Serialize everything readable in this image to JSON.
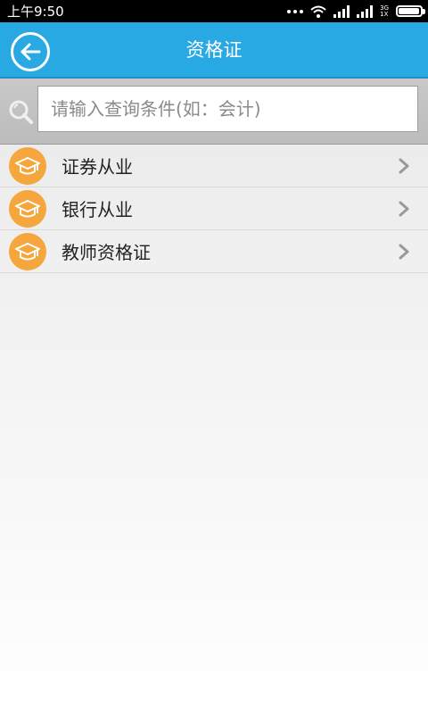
{
  "status_bar": {
    "time": "上午9:50",
    "network_top": "3G",
    "network_bottom": "1X",
    "battery_level": 0.95
  },
  "header": {
    "title": "资格证"
  },
  "search": {
    "placeholder": "请输入查询条件(如：会计)"
  },
  "items": [
    {
      "label": "证券从业",
      "icon": "graduation-cap-icon"
    },
    {
      "label": "银行从业",
      "icon": "graduation-cap-icon"
    },
    {
      "label": "教师资格证",
      "icon": "graduation-cap-icon"
    }
  ],
  "colors": {
    "header": "#29a9e3",
    "icon_badge": "#f5a63c"
  }
}
